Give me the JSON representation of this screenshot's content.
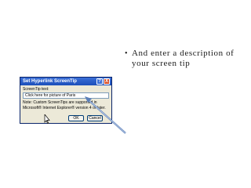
{
  "slide": {
    "bullet": "And enter a description of your screen tip"
  },
  "dialog": {
    "title": "Set Hyperlink ScreenTip",
    "help_glyph": "?",
    "close_glyph": "X",
    "field_label": "ScreenTip text:",
    "input_value": "Click here for picture of Paris",
    "note": "Note: Custom ScreenTips are supported in Microsoft® Internet Explorer® version 4 or later.",
    "ok_label": "OK",
    "cancel_label": "Cancel"
  },
  "icons": {
    "cursor": "mouse-pointer-icon",
    "arrow": "callout-arrow"
  },
  "colors": {
    "titlebar": "#1c4fb9",
    "dialog_bg": "#ece9d8",
    "arrow": "#5b7fb8",
    "close_button": "#d9532c"
  }
}
